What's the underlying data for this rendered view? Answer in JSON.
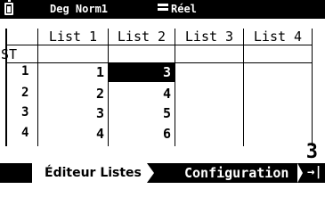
{
  "status_bar": {
    "mode": "Deg Norm1",
    "complex_mode": "Réel"
  },
  "table": {
    "headers": [
      "List 1",
      "List 2",
      "List 3",
      "List 4"
    ],
    "sub_label": "ST",
    "row_labels": [
      "1",
      "2",
      "3",
      "4"
    ],
    "rows": [
      [
        "1",
        "3",
        "",
        ""
      ],
      [
        "2",
        "4",
        "",
        ""
      ],
      [
        "3",
        "5",
        "",
        ""
      ],
      [
        "4",
        "6",
        "",
        ""
      ]
    ],
    "selected_value": "3"
  },
  "display_value": "3",
  "function_bar": {
    "tab1": "Éditeur Listes",
    "tab2": "Configuration"
  },
  "icons": [
    "battery-icon",
    "fraction-icon",
    "next-page-icon"
  ]
}
